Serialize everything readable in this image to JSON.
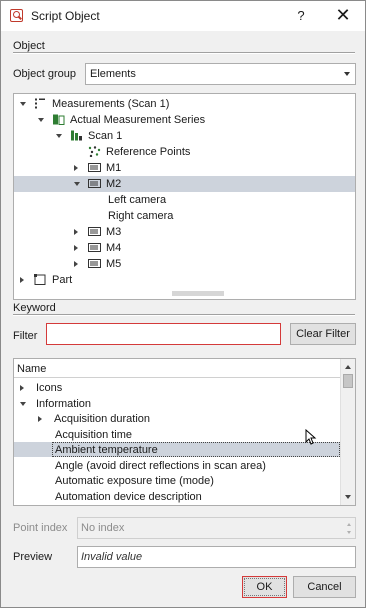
{
  "window": {
    "title": "Script Object",
    "help_label": "?",
    "close_label": "✕"
  },
  "object_section": {
    "header": "Object",
    "group_label": "Object group",
    "group_value": "Elements"
  },
  "tree": [
    {
      "label": "Measurements (Scan 1)",
      "expander": "open",
      "icon": "measurements-icon"
    },
    {
      "label": "Actual Measurement Series",
      "expander": "open",
      "icon": "measurement-series-icon"
    },
    {
      "label": "Scan 1",
      "expander": "open",
      "icon": "scan-icon"
    },
    {
      "label": "Reference Points",
      "expander": "none",
      "icon": "reference-points-icon"
    },
    {
      "label": "M1",
      "expander": "closed",
      "icon": "measurement-icon"
    },
    {
      "label": "M2",
      "expander": "open",
      "icon": "measurement-icon",
      "selected": true
    },
    {
      "label": "Left camera",
      "expander": "none",
      "icon": ""
    },
    {
      "label": "Right camera",
      "expander": "none",
      "icon": ""
    },
    {
      "label": "M3",
      "expander": "closed",
      "icon": "measurement-icon"
    },
    {
      "label": "M4",
      "expander": "closed",
      "icon": "measurement-icon"
    },
    {
      "label": "M5",
      "expander": "closed",
      "icon": "measurement-icon"
    },
    {
      "label": "Part",
      "expander": "closed",
      "icon": "part-icon"
    }
  ],
  "keyword_section": {
    "header": "Keyword",
    "filter_label": "Filter",
    "filter_value": "",
    "clear_label": "Clear Filter",
    "column_name": "Name"
  },
  "keywords": [
    {
      "label": "Icons",
      "expander": "closed"
    },
    {
      "label": "Information",
      "expander": "open"
    },
    {
      "label": "Acquisition duration",
      "expander": "closed"
    },
    {
      "label": "Acquisition time",
      "expander": "none"
    },
    {
      "label": "Ambient temperature",
      "expander": "none",
      "selected": true
    },
    {
      "label": "Angle (avoid direct reflections in scan area)",
      "expander": "none"
    },
    {
      "label": "Automatic exposure time (mode)",
      "expander": "none"
    },
    {
      "label": "Automation device description",
      "expander": "none"
    }
  ],
  "point_index": {
    "label": "Point index",
    "value": "No index"
  },
  "preview": {
    "label": "Preview",
    "value": "Invalid value"
  },
  "buttons": {
    "ok": "OK",
    "cancel": "Cancel"
  },
  "colors": {
    "selection": "#cdd3dc",
    "accent_red": "#d43a3a",
    "icon_green": "#2e7d32"
  }
}
